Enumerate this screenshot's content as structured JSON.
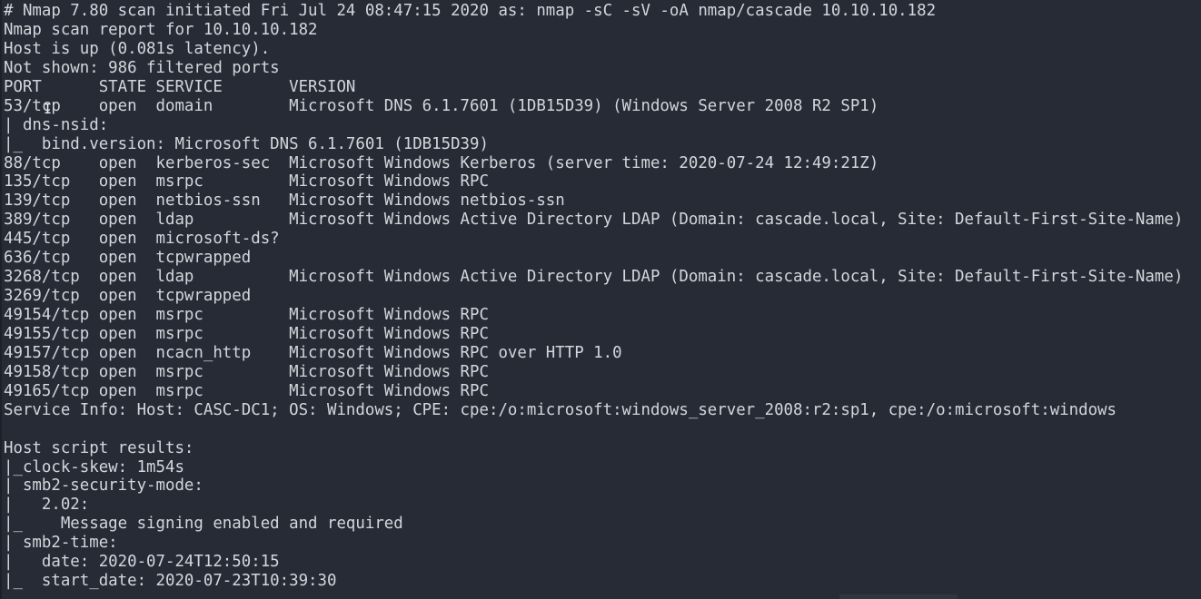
{
  "terminal": {
    "lines": [
      "# Nmap 7.80 scan initiated Fri Jul 24 08:47:15 2020 as: nmap -sC -sV -oA nmap/cascade 10.10.10.182",
      "Nmap scan report for 10.10.10.182",
      "Host is up (0.081s latency).",
      "Not shown: 986 filtered ports",
      "PORT      STATE SERVICE       VERSION",
      "53/tcp    open  domain        Microsoft DNS 6.1.7601 (1DB15D39) (Windows Server 2008 R2 SP1)",
      "| dns-nsid:",
      "|_  bind.version: Microsoft DNS 6.1.7601 (1DB15D39)",
      "88/tcp    open  kerberos-sec  Microsoft Windows Kerberos (server time: 2020-07-24 12:49:21Z)",
      "135/tcp   open  msrpc         Microsoft Windows RPC",
      "139/tcp   open  netbios-ssn   Microsoft Windows netbios-ssn",
      "389/tcp   open  ldap          Microsoft Windows Active Directory LDAP (Domain: cascade.local, Site: Default-First-Site-Name)",
      "445/tcp   open  microsoft-ds?",
      "636/tcp   open  tcpwrapped",
      "3268/tcp  open  ldap          Microsoft Windows Active Directory LDAP (Domain: cascade.local, Site: Default-First-Site-Name)",
      "3269/tcp  open  tcpwrapped",
      "49154/tcp open  msrpc         Microsoft Windows RPC",
      "49155/tcp open  msrpc         Microsoft Windows RPC",
      "49157/tcp open  ncacn_http    Microsoft Windows RPC over HTTP 1.0",
      "49158/tcp open  msrpc         Microsoft Windows RPC",
      "49165/tcp open  msrpc         Microsoft Windows RPC",
      "Service Info: Host: CASC-DC1; OS: Windows; CPE: cpe:/o:microsoft:windows_server_2008:r2:sp1, cpe:/o:microsoft:windows",
      "",
      "Host script results:",
      "|_clock-skew: 1m54s",
      "| smb2-security-mode:",
      "|   2.02:",
      "|_    Message signing enabled and required",
      "| smb2-time:",
      "|   date: 2020-07-24T12:50:15",
      "|_  start_date: 2020-07-23T10:39:30"
    ]
  },
  "icons": {
    "text_cursor": "I-beam-cursor-icon",
    "text_cursor_glyph": "I"
  },
  "colors": {
    "background": "#262b36",
    "foreground": "#d4d6db"
  }
}
